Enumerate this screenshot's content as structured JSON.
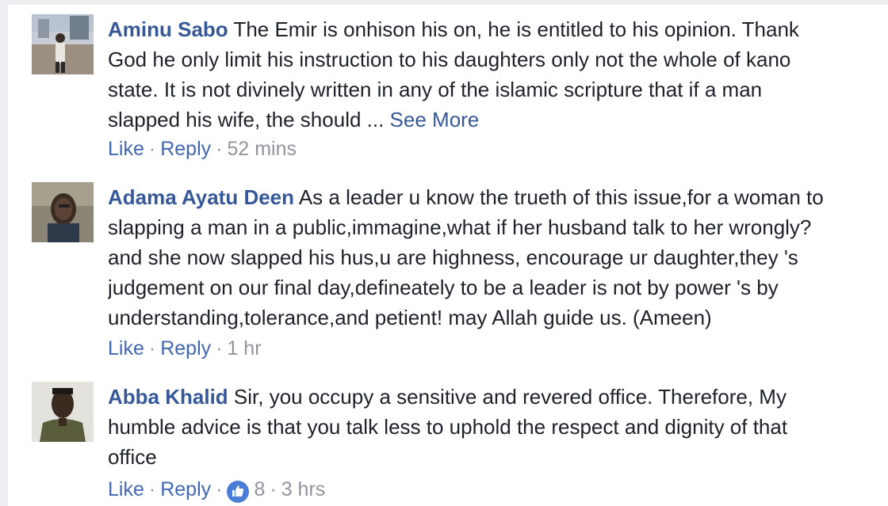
{
  "comments": [
    {
      "name": "Aminu Sabo",
      "lines": [
        "The Emir is onhison his on, he is entitled to his opinion. Thank",
        "God he only limit his instruction to his daughters only not the whole of kano",
        "state. It is not divinely written in any of the islamic scripture that if a man",
        "slapped his wife, the should ... "
      ],
      "see_more": "See More",
      "like": "Like",
      "reply": "Reply",
      "time": "52 mins"
    },
    {
      "name": "Adama Ayatu Deen",
      "lines": [
        "As a leader u know the trueth of this issue,for a woman to",
        "slapping a man in a public,immagine,what if her husband talk to her wrongly?",
        "and she now slapped his hus,u are highness, encourage ur daughter,they 's",
        "judgement on our final day,defineately to be a leader is not by power 's by",
        "understanding,tolerance,and petient! may Allah guide us. (Ameen)"
      ],
      "like": "Like",
      "reply": "Reply",
      "time": "1 hr"
    },
    {
      "name": "Abba Khalid",
      "lines": [
        "Sir, you occupy a sensitive and revered office. Therefore, My",
        "humble advice is that you talk less to uphold the respect and dignity of that",
        "office"
      ],
      "like": "Like",
      "reply": "Reply",
      "reactions": "8",
      "time": "3 hrs"
    }
  ],
  "separator": "·",
  "colors": {
    "name": "#365899",
    "link": "#4267b2",
    "meta": "#90949c",
    "like_badge": "#4a7dd8"
  }
}
